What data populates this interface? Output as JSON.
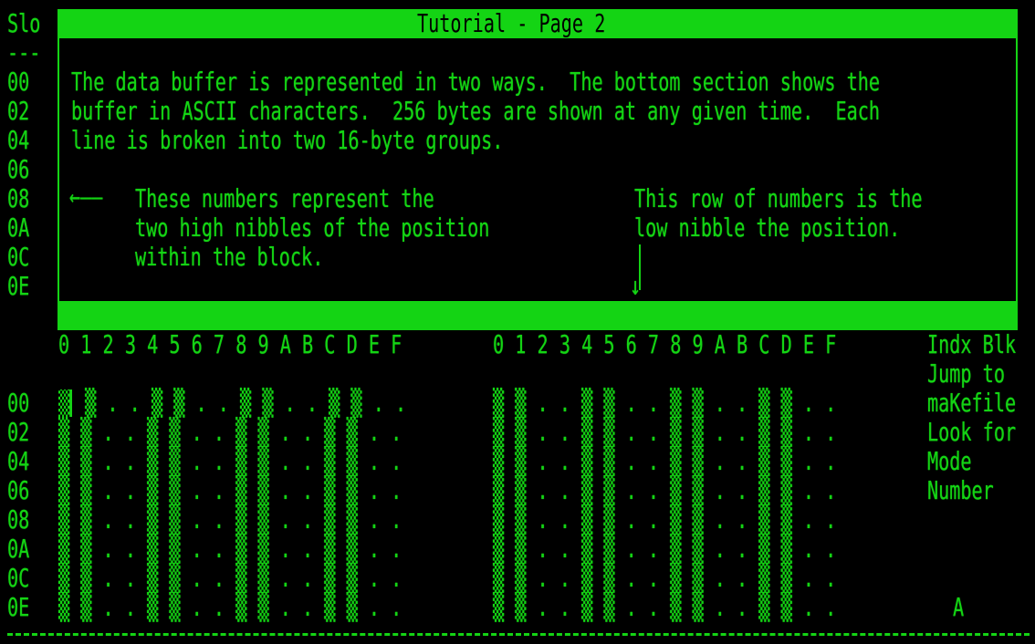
{
  "left_column": {
    "header": "Slo",
    "divider": "---",
    "top_labels": [
      "00",
      "02",
      "04",
      "06",
      "08",
      "0A",
      "0C",
      "0E"
    ]
  },
  "dialog": {
    "title": "Tutorial - Page 2",
    "paragraph_lines": [
      "The data buffer is represented in two ways.  The bottom section shows the",
      "buffer in ASCII characters.  256 bytes are shown at any given time.  Each",
      "line is broken into two 16-byte groups."
    ],
    "left_arrow": "←——",
    "left_note_lines": [
      "These numbers represent the",
      "two high nibbles of the position",
      "within the block."
    ],
    "right_note_lines": [
      "This row of numbers is the",
      "low nibble the position."
    ],
    "down_arrow": "↓"
  },
  "buffer": {
    "column_header_group1": "0 1 2 3 4 5 6 7 8 9 A B C D E F",
    "column_header_group2": "0 1 2 3 4 5 6 7 8 9 A B C D E F",
    "row_labels": [
      "00",
      "02",
      "04",
      "06",
      "08",
      "0A",
      "0C",
      "0E"
    ],
    "cursor_cell": "▒",
    "group1_first_row_rest": " ▒ . . ▒ ▒ . . ▒ ▒ . . ▒ ▒ . .",
    "group1_line": "▒ ▒ . . ▒ ▒ . . ▒ ▒ . . ▒ ▒ . .",
    "group2_line": "▒ ▒ . . ▒ ▒ . . ▒ ▒ . . ▒ ▒ . ."
  },
  "side_menu": {
    "items": [
      "Indx Blk",
      "Jump to",
      "maKefile",
      "Look for",
      "Mode",
      "Number"
    ],
    "status_letter": "A"
  },
  "colors": {
    "phosphor_green": "#14d414",
    "background": "#000000"
  }
}
